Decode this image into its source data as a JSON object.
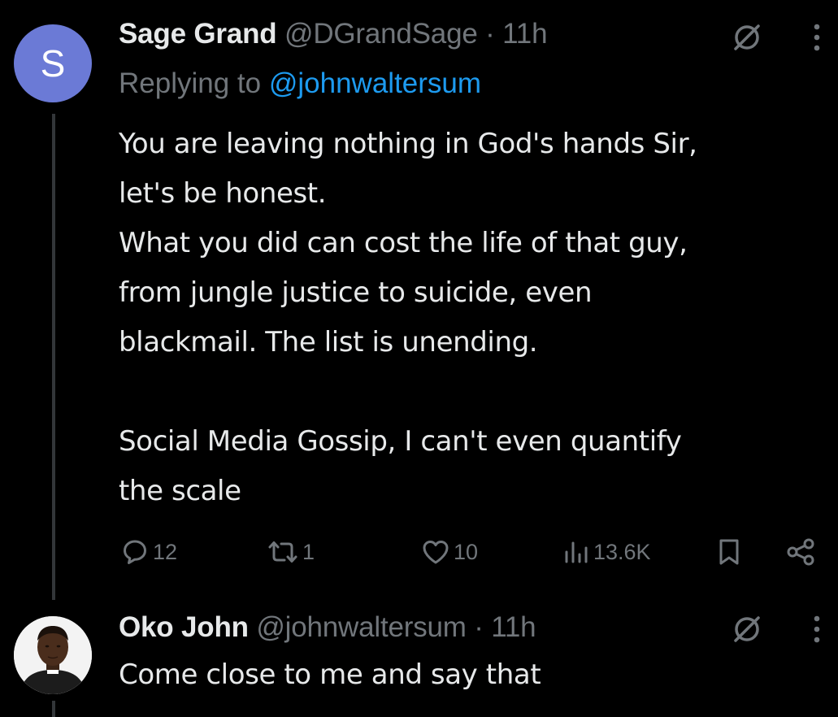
{
  "tweet1": {
    "avatar_letter": "S",
    "display_name": "Sage Grand",
    "handle": "@DGrandSage",
    "separator": "·",
    "time": "11h",
    "replying_to_label": "Replying to",
    "replying_to_handle": "@johnwaltersum",
    "text_lines": [
      "You are leaving nothing in God's hands Sir,",
      "let's be honest.",
      "What you did can cost the life of that guy,",
      "from jungle justice to suicide, even",
      "blackmail. The list is unending.",
      "Social Media Gossip, I can't even quantify",
      "the scale"
    ],
    "actions": {
      "replies": "12",
      "reposts": "1",
      "likes": "10",
      "views": "13.6K"
    }
  },
  "tweet2": {
    "display_name": "Oko John",
    "handle": "@johnwaltersum",
    "separator": "·",
    "time": "11h",
    "text": "Come close to me and say that"
  },
  "icons": {
    "grok": "grok-slash-circle-icon",
    "more": "more-vertical-icon",
    "reply": "speech-bubble-icon",
    "repost": "repost-arrows-icon",
    "like": "heart-icon",
    "views": "bar-chart-icon",
    "bookmark": "bookmark-icon",
    "share": "share-icon"
  },
  "colors": {
    "background": "#000000",
    "text": "#e7e9ea",
    "muted": "#71767b",
    "link": "#1d9bf0",
    "avatar_bg": "#6b7ad6"
  }
}
